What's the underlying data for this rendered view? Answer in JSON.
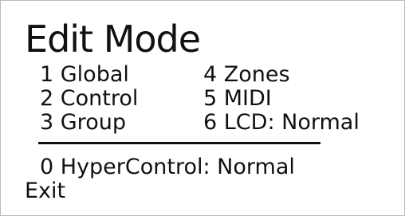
{
  "screen": {
    "title": "Edit Mode",
    "menu": {
      "items": [
        {
          "label": "1 Global"
        },
        {
          "label": "2 Control"
        },
        {
          "label": "3 Group"
        },
        {
          "label": "4 Zones"
        },
        {
          "label": "5 MIDI"
        },
        {
          "label": "6 LCD: Normal"
        }
      ]
    },
    "hyper_control": "0 HyperControl: Normal",
    "exit": "Exit"
  }
}
